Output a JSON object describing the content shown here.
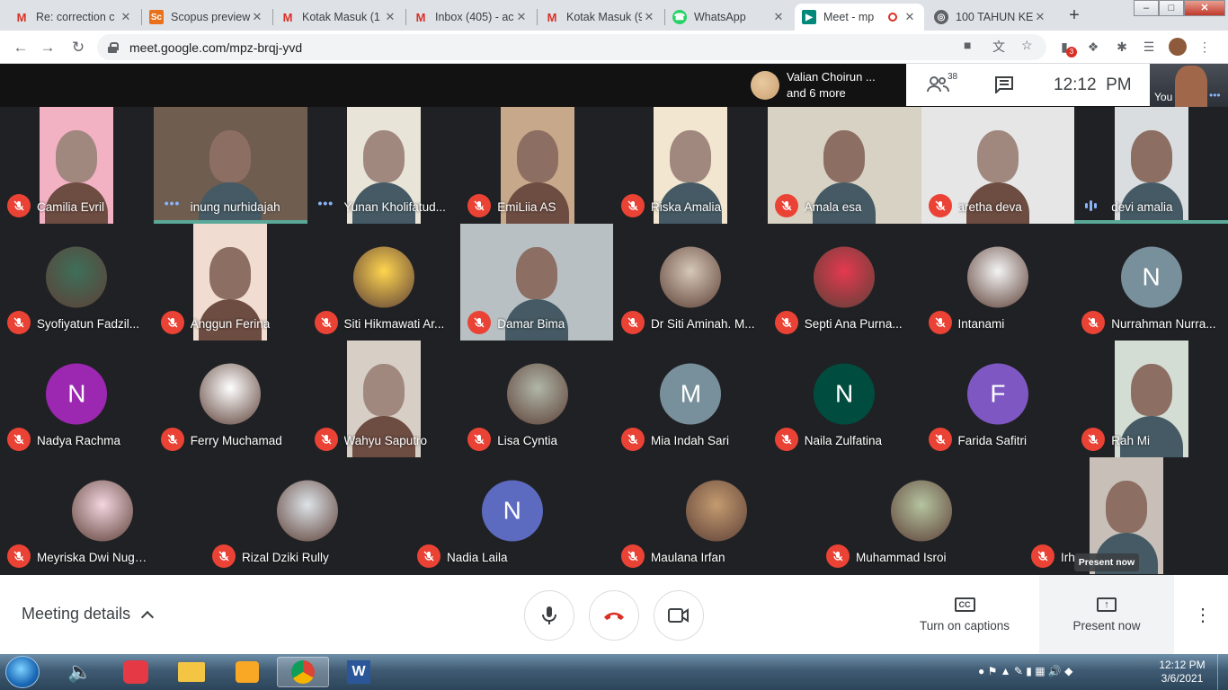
{
  "browser": {
    "tabs": [
      {
        "icon": "gmail-icon",
        "title": "Re: correction c"
      },
      {
        "icon": "scopus-icon",
        "title": "Scopus preview"
      },
      {
        "icon": "gmail-icon",
        "title": "Kotak Masuk (1"
      },
      {
        "icon": "gmail-icon",
        "title": "Inbox (405) - ac"
      },
      {
        "icon": "gmail-icon",
        "title": "Kotak Masuk (9"
      },
      {
        "icon": "whatsapp-icon",
        "title": "WhatsApp"
      },
      {
        "icon": "meet-icon",
        "title": "Meet - mp"
      },
      {
        "icon": "globe-icon",
        "title": "100 TAHUN KE"
      }
    ],
    "url": "meet.google.com/mpz-brqj-yvd",
    "extension_badge": "3"
  },
  "meet": {
    "notification": {
      "line1": "Valian Choirun ...",
      "line2": "and 6 more"
    },
    "participant_count": "38",
    "time": "12:12  PM",
    "self_label": "You",
    "participants": [
      {
        "name": "Camilia Evril",
        "status": "muted",
        "kind": "video"
      },
      {
        "name": "inung nurhidajah",
        "status": "dots",
        "kind": "video"
      },
      {
        "name": "Yunan Kholifatud...",
        "status": "dots",
        "kind": "video"
      },
      {
        "name": "EmiLiia AS",
        "status": "muted",
        "kind": "video"
      },
      {
        "name": "Riska Amalia",
        "status": "muted",
        "kind": "video"
      },
      {
        "name": "Amala esa",
        "status": "muted",
        "kind": "video"
      },
      {
        "name": "aretha deva",
        "status": "muted",
        "kind": "video"
      },
      {
        "name": "devi amalia",
        "status": "speaking",
        "kind": "video"
      },
      {
        "name": "Syofiyatun Fadzil...",
        "status": "muted",
        "kind": "photo"
      },
      {
        "name": "Anggun Ferina",
        "status": "muted",
        "kind": "video"
      },
      {
        "name": "Siti Hikmawati Ar...",
        "status": "muted",
        "kind": "photo"
      },
      {
        "name": "Damar Bima",
        "status": "muted",
        "kind": "video"
      },
      {
        "name": "Dr Siti Aminah. M...",
        "status": "muted",
        "kind": "photo"
      },
      {
        "name": "Septi Ana Purna...",
        "status": "muted",
        "kind": "photo"
      },
      {
        "name": "Intanami",
        "status": "muted",
        "kind": "photo"
      },
      {
        "name": "Nurrahman Nurra...",
        "status": "muted",
        "kind": "letter",
        "letter": "N",
        "color": "#78909c"
      },
      {
        "name": "Nadya Rachma",
        "status": "muted",
        "kind": "letter",
        "letter": "N",
        "color": "#9c27b0"
      },
      {
        "name": "Ferry Muchamad",
        "status": "muted",
        "kind": "photo"
      },
      {
        "name": "Wahyu Saputro",
        "status": "muted",
        "kind": "video"
      },
      {
        "name": "Lisa Cyntia",
        "status": "muted",
        "kind": "photo"
      },
      {
        "name": "Mia Indah Sari",
        "status": "muted",
        "kind": "letter",
        "letter": "M",
        "color": "#78909c"
      },
      {
        "name": "Naila Zulfatina",
        "status": "muted",
        "kind": "letter",
        "letter": "N",
        "color": "#004d40"
      },
      {
        "name": "Farida Safitri",
        "status": "muted",
        "kind": "letter",
        "letter": "F",
        "color": "#7e57c2"
      },
      {
        "name": "Rah Mi",
        "status": "muted",
        "kind": "video"
      },
      {
        "name": "Meyriska Dwi Nugraheni",
        "status": "muted",
        "kind": "photo"
      },
      {
        "name": "Rizal Dziki Rully",
        "status": "muted",
        "kind": "photo"
      },
      {
        "name": "Nadia Laila",
        "status": "muted",
        "kind": "letter",
        "letter": "N",
        "color": "#5c6bc0"
      },
      {
        "name": "Maulana Irfan",
        "status": "muted",
        "kind": "photo"
      },
      {
        "name": "Muhammad Isroi",
        "status": "muted",
        "kind": "photo"
      },
      {
        "name": "Irh",
        "status": "muted",
        "kind": "video"
      }
    ],
    "tooltip": "Present now",
    "controls": {
      "meeting_details": "Meeting details",
      "captions": "Turn on captions",
      "captions_icon": "CC",
      "present": "Present now"
    }
  },
  "taskbar": {
    "time": "12:12 PM",
    "date": "3/6/2021"
  }
}
